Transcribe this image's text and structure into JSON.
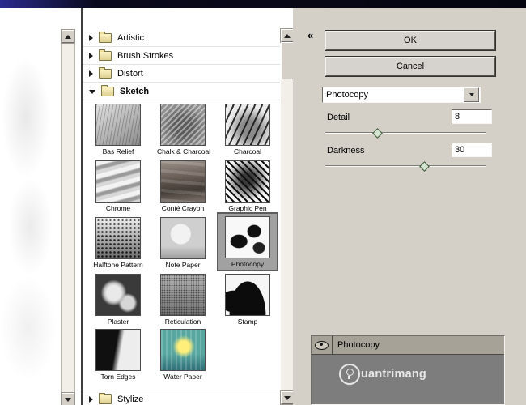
{
  "filter_list": {
    "categories": [
      {
        "label": "Artistic"
      },
      {
        "label": "Brush Strokes"
      },
      {
        "label": "Distort"
      },
      {
        "label": "Sketch"
      },
      {
        "label": "Stylize"
      }
    ],
    "thumbnails": [
      "Bas Relief",
      "Chalk & Charcoal",
      "Charcoal",
      "Chrome",
      "Conté Crayon",
      "Graphic Pen",
      "Halftone Pattern",
      "Note Paper",
      "Photocopy",
      "Plaster",
      "Reticulation",
      "Stamp",
      "Torn Edges",
      "Water Paper"
    ],
    "selected_thumbnail": "Photocopy"
  },
  "controls": {
    "collapse_glyph": "«",
    "ok": "OK",
    "cancel": "Cancel",
    "filter_name": "Photocopy",
    "detail": {
      "label": "Detail",
      "value": "8"
    },
    "darkness": {
      "label": "Darkness",
      "value": "30"
    }
  },
  "effects_panel": {
    "item": "Photocopy"
  },
  "watermark": {
    "text": "uantrimang"
  }
}
